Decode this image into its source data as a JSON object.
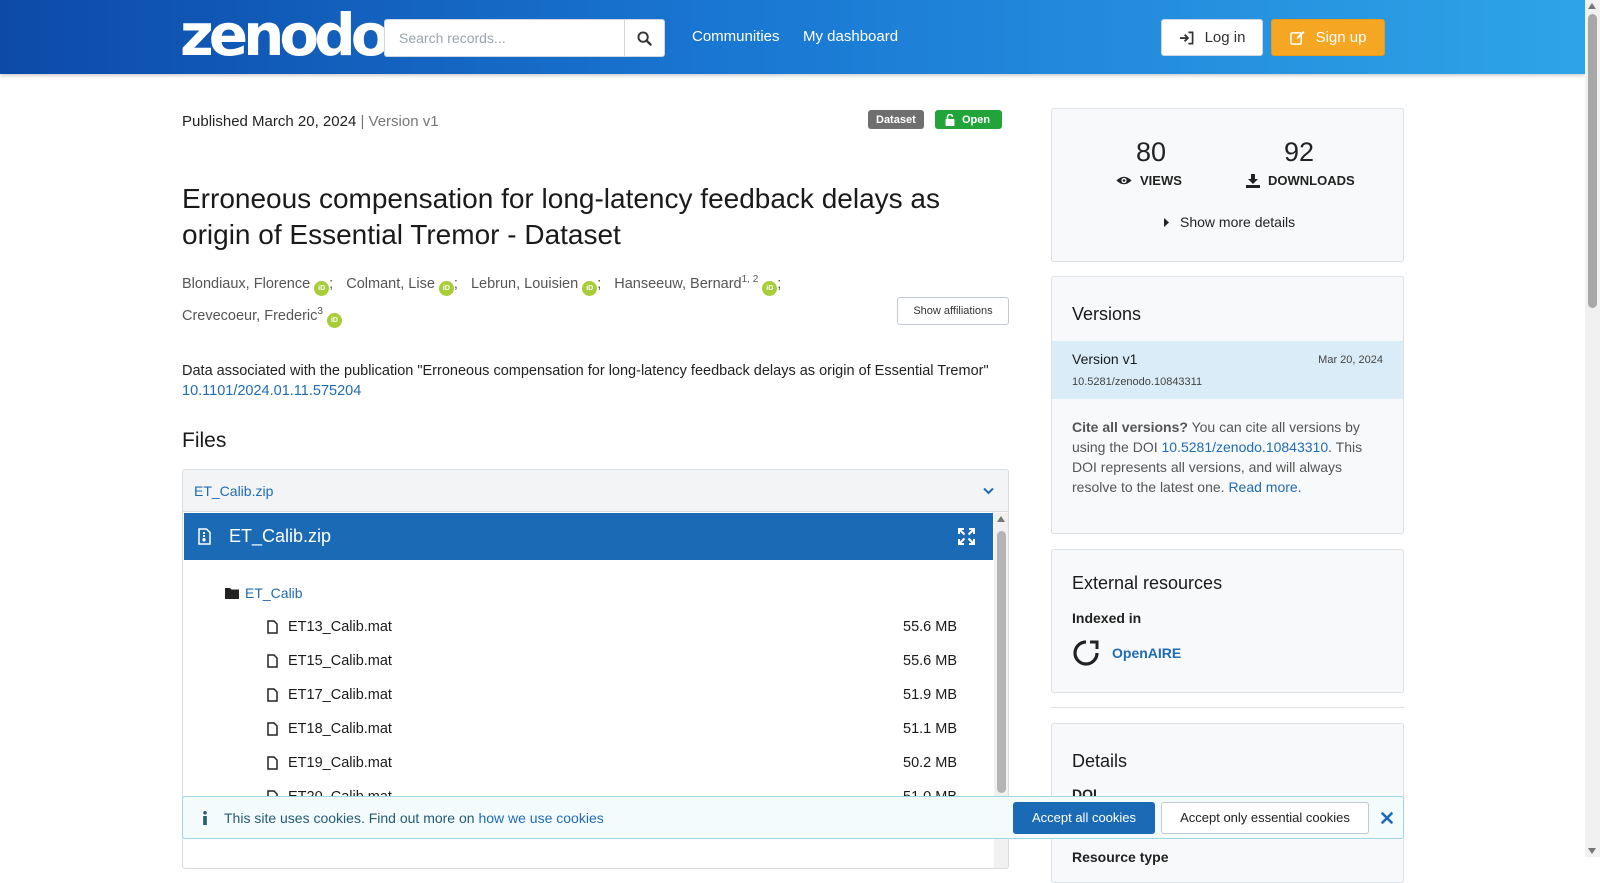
{
  "header": {
    "logo": "zenodo",
    "search_placeholder": "Search records...",
    "nav": [
      "Communities",
      "My dashboard"
    ],
    "login_label": "Log in",
    "signup_label": "Sign up"
  },
  "record": {
    "published_label": "Published March 20, 2024",
    "version_label": "Version v1",
    "badge_type": "Dataset",
    "badge_access": "Open",
    "title": "Erroneous compensation for long-latency feedback delays as origin of Essential Tremor - Dataset",
    "creators": [
      {
        "name": "Blondiaux, Florence",
        "sup": ""
      },
      {
        "name": "Colmant, Lise",
        "sup": ""
      },
      {
        "name": "Lebrun, Louisien",
        "sup": ""
      },
      {
        "name": "Hanseeuw, Bernard",
        "sup": "1, 2"
      },
      {
        "name": "Crevecoeur, Frederic",
        "sup": "3"
      }
    ],
    "orcid_label": "iD",
    "affiliations_button": "Show affiliations",
    "description": "Data associated with the publication \"Erroneous compensation for long-latency feedback delays as origin of Essential Tremor\"",
    "related_doi": "10.1101/2024.01.11.575204"
  },
  "files": {
    "heading": "Files",
    "accordion_label": "ET_Calib.zip",
    "preview_title": "ET_Calib.zip",
    "folder": "ET_Calib",
    "items": [
      {
        "name": "ET13_Calib.mat",
        "size": "55.6 MB"
      },
      {
        "name": "ET15_Calib.mat",
        "size": "55.6 MB"
      },
      {
        "name": "ET17_Calib.mat",
        "size": "51.9 MB"
      },
      {
        "name": "ET18_Calib.mat",
        "size": "51.1 MB"
      },
      {
        "name": "ET19_Calib.mat",
        "size": "50.2 MB"
      },
      {
        "name": "ET20_Calib.mat",
        "size": "51.0 MB"
      }
    ]
  },
  "stats": {
    "views": "80",
    "views_label": "VIEWS",
    "downloads": "92",
    "downloads_label": "DOWNLOADS",
    "more_details": "Show more details"
  },
  "versions": {
    "heading": "Versions",
    "active_name": "Version v1",
    "active_date": "Mar 20, 2024",
    "active_doi": "10.5281/zenodo.10843311",
    "cite_bold": "Cite all versions?",
    "cite_text_1": " You can cite all versions by using the DOI ",
    "concept_doi": "10.5281/zenodo.10843310",
    "cite_text_2": ". This DOI represents all versions, and will always resolve to the latest one. ",
    "read_more": "Read more",
    "cite_end": "."
  },
  "external": {
    "heading": "External resources",
    "indexed_in": "Indexed in",
    "openaire": "OpenAIRE"
  },
  "details": {
    "heading": "Details",
    "doi_label": "DOI",
    "resource_type_label": "Resource type"
  },
  "cookie": {
    "text": "This site uses cookies. Find out more on ",
    "link": "how we use cookies",
    "accept_all": "Accept all cookies",
    "accept_essential": "Accept only essential cookies"
  },
  "colors": {
    "header_start": "#0d4aa8",
    "header_end": "#2ea4e8",
    "signup": "#f5a623",
    "open_badge": "#21a43a",
    "preview_bar": "#1b6ab5",
    "orcid": "#a6ce39",
    "active_version_bg": "#d9ecf7"
  },
  "icons": [
    "search-icon",
    "sign-in-icon",
    "edit-icon",
    "lock-open-icon",
    "eye-icon",
    "download-icon",
    "caret-right-icon",
    "chevron-down-icon",
    "file-archive-icon",
    "expand-icon",
    "folder-icon",
    "file-icon",
    "info-icon",
    "close-icon",
    "openaire-icon"
  ]
}
